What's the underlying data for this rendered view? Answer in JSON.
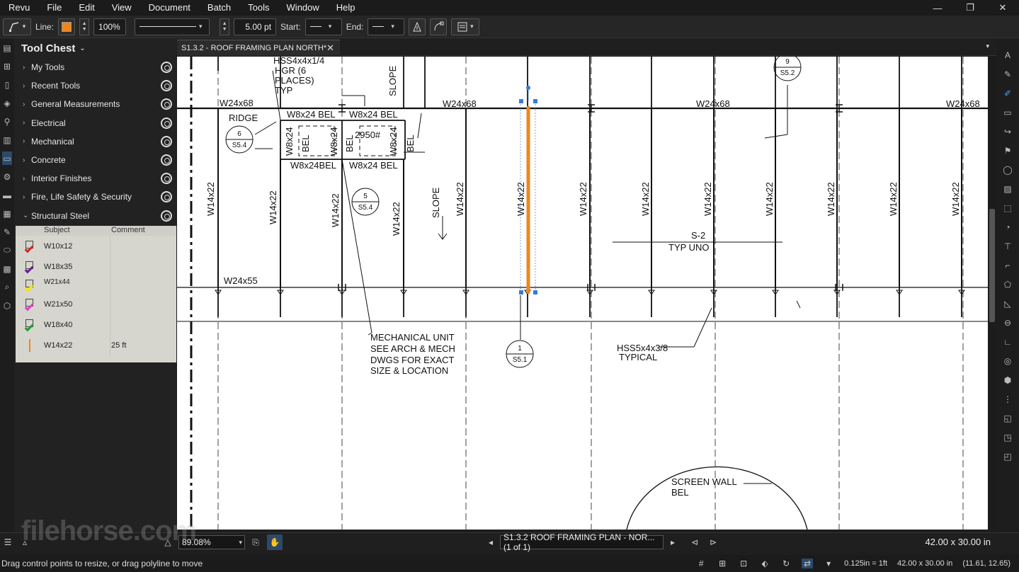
{
  "menubar": {
    "items": [
      "Revu",
      "File",
      "Edit",
      "View",
      "Document",
      "Batch",
      "Tools",
      "Window",
      "Help"
    ],
    "window_controls": [
      "—",
      "❐",
      "✕"
    ]
  },
  "toolbar": {
    "line_label": "Line:",
    "line_color": "#f0851e",
    "opacity": "100%",
    "width": "5.00 pt",
    "start_label": "Start:",
    "end_label": "End:"
  },
  "tool_chest": {
    "title": "Tool Chest",
    "items": [
      {
        "label": "My Tools",
        "expanded": false
      },
      {
        "label": "Recent Tools",
        "expanded": false
      },
      {
        "label": "General Measurements",
        "expanded": false
      },
      {
        "label": "Electrical",
        "expanded": false
      },
      {
        "label": "Mechanical",
        "expanded": false
      },
      {
        "label": "Concrete",
        "expanded": false
      },
      {
        "label": "Interior Finishes",
        "expanded": false
      },
      {
        "label": "Fire, Life Safety & Security",
        "expanded": false
      },
      {
        "label": "Structural Steel",
        "expanded": true
      }
    ],
    "table": {
      "headers": [
        "Subject",
        "Comment"
      ],
      "rows": [
        {
          "subject": "W10x12",
          "comment": "",
          "color": "#e0231c"
        },
        {
          "subject": "W18x35",
          "comment": "",
          "color": "#6a1b9a"
        },
        {
          "subject": "W21x44",
          "comment": "",
          "color": "#f2e600"
        },
        {
          "subject": "W21x50",
          "comment": "",
          "color": "#e53ad8"
        },
        {
          "subject": "W18x40",
          "comment": "",
          "color": "#1f9d2a"
        },
        {
          "subject": "W14x22",
          "comment": "25 ft",
          "color": "#f0851e"
        }
      ]
    }
  },
  "tab": {
    "title": "S1.3.2 - ROOF FRAMING PLAN NORTH*"
  },
  "drawing": {
    "top_beams": [
      "W24x68",
      "W24x68",
      "W24x68",
      "W24x68"
    ],
    "bottom_beam": "W24x55",
    "columns": [
      "W14x22",
      "W14x22",
      "W14x22",
      "W14x22",
      "W14x22",
      "W14x22",
      "W14x22",
      "W14x22",
      "W14x22",
      "W14x22",
      "W14x22",
      "W14x22",
      "W14x22"
    ],
    "hss_note": [
      "HSS4x4x1/4",
      "HGR (6",
      "PLACES)",
      "TYP"
    ],
    "slope": "SLOPE",
    "ridge": "RIDGE",
    "w8_top": [
      "W8x24 BEL",
      "W8x24 BEL"
    ],
    "w8_bottom": [
      "W8x24BEL",
      "W8x24 BEL"
    ],
    "w8_vert": [
      "W8x24",
      "BEL",
      "W8x24",
      "BEL",
      "W8x24",
      "BEL"
    ],
    "load": "2950#",
    "callouts": [
      {
        "num": "6",
        "sheet": "S5.4"
      },
      {
        "num": "5",
        "sheet": "S5.4"
      },
      {
        "num": "1",
        "sheet": "S5.1"
      },
      {
        "num": "9",
        "sheet": "S5.2"
      }
    ],
    "s2": [
      "S-2",
      "TYP  UNO"
    ],
    "mech_note": [
      "MECHANICAL UNIT",
      "SEE ARCH & MECH",
      "DWGS FOR EXACT",
      "SIZE & LOCATION"
    ],
    "hss_typ": [
      "HSS5x4x3/8",
      "TYPICAL"
    ],
    "screen_wall": [
      "SCREEN WALL",
      "BEL"
    ]
  },
  "navbar": {
    "zoom": "89.08%",
    "page": "S1.3.2 ROOF FRAMING PLAN - NOR... (1 of 1)",
    "page_size": "42.00 x 30.00 in"
  },
  "statusbar": {
    "text": "Drag control points to resize, or drag polyline to move",
    "scale": "0.125in = 1ft",
    "size": "42.00 x 30.00 in",
    "coords": "(11.61, 12.65)"
  },
  "watermark": "filehorse.com"
}
